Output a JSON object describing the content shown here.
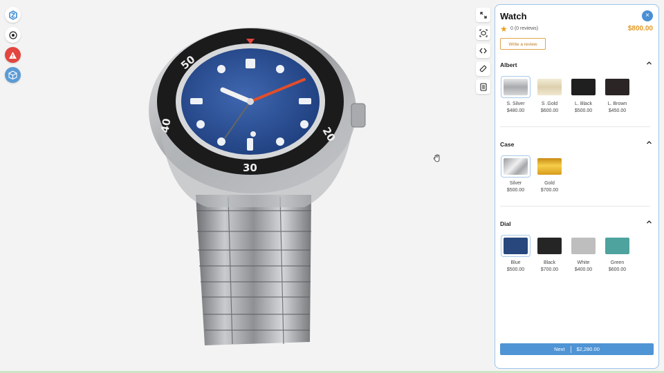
{
  "product": {
    "title": "Watch",
    "reviews_text": "0 (0 reviews)",
    "price": "$800.00",
    "write_review_label": "Write a review",
    "close_label": "×"
  },
  "sections": {
    "albert": {
      "title": "Albert",
      "options": [
        {
          "name": "S. Silver",
          "price": "$480.00",
          "color": "#c9cacc",
          "selected": true
        },
        {
          "name": "S .Gold",
          "price": "$600.00",
          "color": "#e9dfc4",
          "selected": false
        },
        {
          "name": "L. Black",
          "price": "$500.00",
          "color": "#1f1f1f",
          "selected": false
        },
        {
          "name": "L. Brown",
          "price": "$450.00",
          "color": "#2b2526",
          "selected": false
        }
      ]
    },
    "case": {
      "title": "Case",
      "options": [
        {
          "name": "Silver",
          "price": "$500.00",
          "color": "#c8c9cb",
          "selected": true
        },
        {
          "name": "Gold",
          "price": "$700.00",
          "color": "#e0a624",
          "selected": false
        }
      ]
    },
    "dial": {
      "title": "Dial",
      "options": [
        {
          "name": "Blue",
          "price": "$500.00",
          "color": "#27477d",
          "selected": true
        },
        {
          "name": "Black",
          "price": "$700.00",
          "color": "#252525",
          "selected": false
        },
        {
          "name": "White",
          "price": "$400.00",
          "color": "#bebebe",
          "selected": false
        },
        {
          "name": "Green",
          "price": "$600.00",
          "color": "#4ea39e",
          "selected": false
        }
      ]
    }
  },
  "footer": {
    "next_label": "Next",
    "total": "$2,280.00"
  },
  "bezel": {
    "numbers": [
      "50",
      "40",
      "30",
      "20"
    ]
  },
  "colors": {
    "accent": "#4f94d4",
    "price": "#e39a26",
    "alert": "#e2463e"
  },
  "icons": {
    "left_tools": [
      "logo-icon",
      "eye-icon",
      "warning-icon",
      "cube-icon"
    ],
    "right_tools": [
      "fullscreen-icon",
      "ar-camera-icon",
      "embed-code-icon",
      "measure-icon",
      "notes-icon"
    ]
  }
}
